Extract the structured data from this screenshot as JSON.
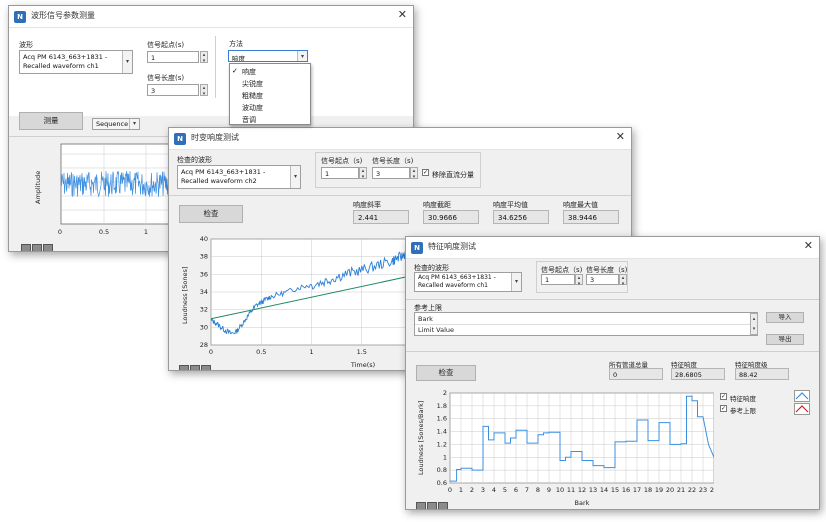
{
  "win1": {
    "title": "波形信号参数测量",
    "waveform_label": "波形",
    "waveform_value": "Acq PM 6143_663+1831 - Recalled waveform ch1",
    "start_label": "信号起点(s)",
    "start_value": "1",
    "length_label": "信号长度(s)",
    "length_value": "3",
    "method_label": "方法",
    "method_value": "响度",
    "method_options": [
      "响度",
      "尖锐度",
      "粗糙度",
      "波动度",
      "音调"
    ],
    "method_checked": "✓",
    "measure_button": "测量",
    "mode_value": "Sequence",
    "plot_ylabel": "Amplitude",
    "plot_xticks": [
      "0",
      "0.5",
      "1"
    ]
  },
  "win2": {
    "title": "时变响度测试",
    "waveform_label": "检查的波形",
    "waveform_value": "Acq PM 6143_663+1831 - Recalled waveform ch2",
    "start_label": "信号起点（s)",
    "start_value": "1",
    "length_label": "信号长度（s)",
    "length_value": "3",
    "rm_dc_label": "移除直流分量",
    "check_button": "检查",
    "stats": [
      {
        "label": "响度斜率",
        "value": "2.441"
      },
      {
        "label": "响度截距",
        "value": "30.9666"
      },
      {
        "label": "响度平均值",
        "value": "34.6256"
      },
      {
        "label": "响度最大值",
        "value": "38.9446"
      }
    ],
    "plot_ylabel": "Loudness [Sones]",
    "plot_xlabel": "Time(s)",
    "plot_yticks": [
      "28",
      "30",
      "32",
      "34",
      "36",
      "38",
      "40"
    ],
    "plot_xticks": [
      "0",
      "0.5",
      "1",
      "1.5"
    ]
  },
  "win3": {
    "title": "特征响度测试",
    "waveform_label": "检查的波形",
    "waveform_value": "Acq PM 6143_663+1831 - Recalled waveform ch1",
    "start_label": "信号起点（s)",
    "start_value": "1",
    "length_label": "信号长度（s)",
    "length_value": "3",
    "ref_label": "参考上限",
    "ref_row1": "Bark",
    "ref_row2": "Limit Value",
    "import_button": "导入",
    "export_button": "导出",
    "check_button": "检查",
    "stats": [
      {
        "label": "所有管道总量",
        "value": "0"
      },
      {
        "label": "特征响度",
        "value": "28.6805"
      },
      {
        "label": "特征响度级",
        "value": "88.42"
      }
    ],
    "legend": [
      {
        "label": "特征响度",
        "color": "#3d8fe0"
      },
      {
        "label": "参考上限",
        "color": "#cc2222"
      }
    ],
    "plot_ylabel": "Loudness [Sones/Bark]",
    "plot_xlabel": "Bark",
    "plot_yticks": [
      "0.6",
      "0.8",
      "1",
      "1.2",
      "1.4",
      "1.6",
      "1.8",
      "2"
    ],
    "plot_xticks": [
      "0",
      "1",
      "2",
      "3",
      "4",
      "5",
      "6",
      "7",
      "8",
      "9",
      "10",
      "11",
      "12",
      "13",
      "14",
      "15",
      "16",
      "17",
      "18",
      "19",
      "20",
      "21",
      "22",
      "23",
      "24"
    ]
  },
  "chart_data": [
    {
      "type": "line",
      "ylabel": "Amplitude",
      "xlim": [
        0,
        1.15
      ],
      "series": [
        {
          "values_note": "",
          "x": [
            0,
            1.15
          ],
          "y": [
            0,
            0
          ]
        }
      ]
    },
    {
      "type": "line",
      "xlabel": "Time(s)",
      "ylabel": "Loudness [Sones]",
      "xlim": [
        0,
        2.0
      ],
      "ylim": [
        28,
        40
      ],
      "grid": true,
      "series": [
        {
          "x": [
            0,
            0.05,
            0.1,
            0.15,
            0.2,
            0.25,
            0.3,
            0.35,
            0.4,
            0.45,
            0.5,
            0.55,
            0.6,
            0.7,
            0.8,
            0.9,
            1.0,
            1.1,
            1.2,
            1.3,
            1.4,
            1.5,
            1.6,
            1.7,
            1.8,
            1.85,
            1.9,
            1.95,
            2.0
          ],
          "y": [
            30.8,
            30.5,
            30.0,
            29.6,
            29.3,
            29.5,
            30.2,
            31.0,
            31.8,
            32.5,
            32.8,
            33.2,
            33.5,
            33.8,
            34.2,
            34.6,
            34.8,
            35.1,
            35.5,
            35.9,
            36.2,
            36.5,
            36.8,
            37.2,
            37.5,
            37.8,
            38.0,
            38.6,
            38.9
          ]
        },
        {
          "x": [
            0,
            2.0
          ],
          "y": [
            30.97,
            35.85
          ]
        }
      ]
    },
    {
      "type": "line",
      "xlabel": "Bark",
      "ylabel": "Loudness [Sones/Bark]",
      "xlim": [
        0,
        24
      ],
      "ylim": [
        0.6,
        2.0
      ],
      "grid": true,
      "series": [
        {
          "name": "特征响度",
          "x": [
            0,
            0.6,
            0.6,
            1,
            1,
            2,
            2,
            3,
            3,
            3.5,
            3.5,
            4,
            4,
            5,
            5,
            5.5,
            5.5,
            6,
            6,
            7,
            7,
            8,
            8,
            8.5,
            8.5,
            9,
            9,
            10,
            10,
            10.5,
            10.5,
            11,
            11,
            12,
            12,
            13,
            13,
            14,
            14,
            15,
            15,
            16,
            16,
            17,
            17,
            18,
            18,
            19,
            19,
            20,
            20,
            21,
            21,
            21.5,
            21.5,
            22,
            22,
            22.5,
            22.5,
            23,
            23.5,
            24
          ],
          "y": [
            0.63,
            0.63,
            0.81,
            0.81,
            0.83,
            0.83,
            0.8,
            0.8,
            1.48,
            1.48,
            1.27,
            1.27,
            1.38,
            1.38,
            1.22,
            1.22,
            1.3,
            1.3,
            1.42,
            1.42,
            1.22,
            1.22,
            1.35,
            1.35,
            1.38,
            1.38,
            1.39,
            1.39,
            0.95,
            0.95,
            1.0,
            1.0,
            1.09,
            1.09,
            0.95,
            0.95,
            0.87,
            0.87,
            0.84,
            0.84,
            1.24,
            1.24,
            1.25,
            1.25,
            1.58,
            1.58,
            1.26,
            1.26,
            1.54,
            1.54,
            1.2,
            1.2,
            1.21,
            1.21,
            1.95,
            1.95,
            1.88,
            1.88,
            1.63,
            1.63,
            1.2,
            1.0
          ]
        },
        {
          "name": "参考上限",
          "x": [],
          "y": []
        }
      ]
    }
  ]
}
